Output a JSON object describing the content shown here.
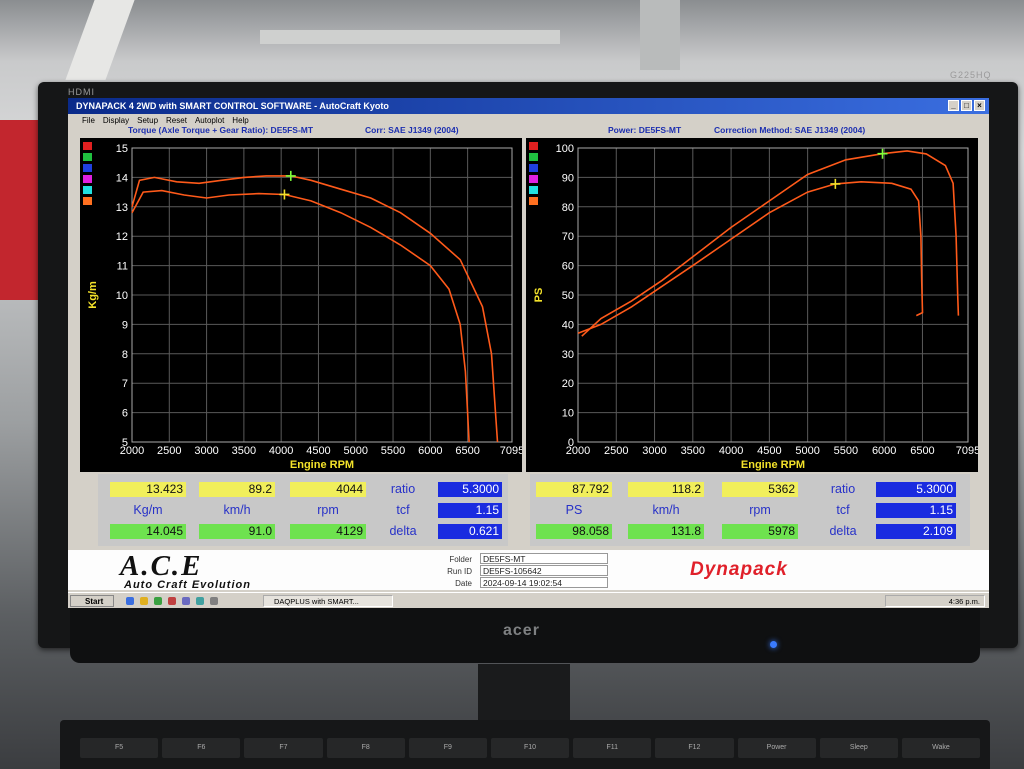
{
  "window": {
    "title": "DYNAPACK 4 2WD with SMART CONTROL SOFTWARE - AutoCraft Kyoto",
    "menu": [
      "File",
      "Display",
      "Setup",
      "Reset",
      "Autoplot",
      "Help"
    ]
  },
  "monitor": {
    "brand": "acer",
    "model": "G225HQ",
    "hdmi": "HDMI"
  },
  "torque_header": {
    "title": "Torque (Axle Torque + Gear Ratio): DE5FS-MT",
    "corr": "Corr: SAE J1349 (2004)"
  },
  "power_header": {
    "title": "Power: DE5FS-MT",
    "method": "Correction Method: SAE J1349 (2004)"
  },
  "chart_data": [
    {
      "type": "line",
      "ylabel": "Kg/m",
      "xlabel": "Engine RPM",
      "xlim": [
        2000,
        7095
      ],
      "ylim": [
        5,
        15
      ],
      "xticks": [
        2000,
        2500,
        3000,
        3500,
        4000,
        4500,
        5000,
        5500,
        6000,
        6500,
        7095
      ],
      "yticks": [
        5,
        6,
        7,
        8,
        9,
        10,
        11,
        12,
        13,
        14,
        15
      ],
      "series": [
        {
          "color": "#ff5a1a",
          "points": [
            [
              2000,
              13.0
            ],
            [
              2100,
              13.9
            ],
            [
              2300,
              14.0
            ],
            [
              2600,
              13.85
            ],
            [
              2900,
              13.8
            ],
            [
              3200,
              13.9
            ],
            [
              3500,
              14.0
            ],
            [
              3800,
              14.05
            ],
            [
              4129,
              14.05
            ],
            [
              4400,
              13.9
            ],
            [
              4800,
              13.6
            ],
            [
              5200,
              13.3
            ],
            [
              5600,
              12.8
            ],
            [
              6000,
              12.1
            ],
            [
              6400,
              11.2
            ],
            [
              6700,
              9.6
            ],
            [
              6820,
              8.0
            ],
            [
              6860,
              6.5
            ],
            [
              6900,
              5.0
            ]
          ]
        },
        {
          "color": "#ff5a1a",
          "points": [
            [
              2000,
              12.8
            ],
            [
              2150,
              13.5
            ],
            [
              2400,
              13.55
            ],
            [
              2700,
              13.4
            ],
            [
              3000,
              13.3
            ],
            [
              3300,
              13.4
            ],
            [
              3700,
              13.45
            ],
            [
              4044,
              13.42
            ],
            [
              4400,
              13.2
            ],
            [
              4800,
              12.8
            ],
            [
              5200,
              12.3
            ],
            [
              5600,
              11.7
            ],
            [
              6000,
              11.0
            ],
            [
              6250,
              10.2
            ],
            [
              6400,
              9.0
            ],
            [
              6470,
              7.4
            ],
            [
              6500,
              6.0
            ],
            [
              6520,
              5.0
            ]
          ]
        }
      ],
      "markers": [
        [
          4129,
          14.05
        ],
        [
          4044,
          13.42
        ]
      ]
    },
    {
      "type": "line",
      "ylabel": "PS",
      "xlabel": "Engine RPM",
      "xlim": [
        2000,
        7095
      ],
      "ylim": [
        0,
        100
      ],
      "xticks": [
        2000,
        2500,
        3000,
        3500,
        4000,
        4500,
        5000,
        5500,
        6000,
        6500,
        7095
      ],
      "yticks": [
        0,
        10,
        20,
        30,
        40,
        50,
        60,
        70,
        80,
        90,
        100
      ],
      "series": [
        {
          "color": "#ff5a1a",
          "points": [
            [
              2050,
              36
            ],
            [
              2300,
              42
            ],
            [
              2700,
              48
            ],
            [
              3100,
              55
            ],
            [
              3500,
              63
            ],
            [
              4000,
              73
            ],
            [
              4500,
              82
            ],
            [
              5000,
              91
            ],
            [
              5500,
              96
            ],
            [
              5978,
              98.06
            ],
            [
              6300,
              99
            ],
            [
              6550,
              98
            ],
            [
              6800,
              94
            ],
            [
              6900,
              88
            ],
            [
              6940,
              70
            ],
            [
              6960,
              50
            ],
            [
              6970,
              43
            ]
          ]
        },
        {
          "color": "#ff5a1a",
          "points": [
            [
              2000,
              37
            ],
            [
              2300,
              40
            ],
            [
              2700,
              46
            ],
            [
              3100,
              53
            ],
            [
              3500,
              60
            ],
            [
              4000,
              69
            ],
            [
              4500,
              78
            ],
            [
              5000,
              85
            ],
            [
              5362,
              87.79
            ],
            [
              5700,
              88.5
            ],
            [
              6100,
              88
            ],
            [
              6350,
              86
            ],
            [
              6450,
              82
            ],
            [
              6480,
              70
            ],
            [
              6490,
              55
            ],
            [
              6500,
              44
            ],
            [
              6420,
              43
            ]
          ]
        }
      ],
      "markers": [
        [
          5978,
          98.06
        ],
        [
          5362,
          87.79
        ]
      ]
    }
  ],
  "readout_left": {
    "row1": [
      "13.423",
      "89.2",
      "4044"
    ],
    "units": [
      "Kg/m",
      "km/h",
      "rpm"
    ],
    "row2": [
      "14.045",
      "91.0",
      "4129"
    ],
    "labels": [
      "ratio",
      "tcf",
      "delta"
    ],
    "values": [
      "5.3000",
      "1.15",
      "0.621"
    ]
  },
  "readout_right": {
    "row1": [
      "87.792",
      "118.2",
      "5362"
    ],
    "units": [
      "PS",
      "km/h",
      "rpm"
    ],
    "row2": [
      "98.058",
      "131.8",
      "5978"
    ],
    "labels": [
      "ratio",
      "tcf",
      "delta"
    ],
    "values": [
      "5.3000",
      "1.15",
      "2.109"
    ]
  },
  "footer": {
    "logo": "A.C.E",
    "logo_sub": "Auto Craft Evolution",
    "folder_label": "Folder",
    "folder": "DE5FS-MT",
    "runid_label": "Run ID",
    "runid": "DE5FS-105642",
    "date_label": "Date",
    "date": "2024-09-14 19:02:54",
    "dynapack": "Dynapack"
  },
  "taskbar": {
    "start": "Start",
    "task": "DAQPLUS with SMART...",
    "clock": "4:36 p.m."
  },
  "keyboard": [
    "F5",
    "F6",
    "F7",
    "F8",
    "F9",
    "F10",
    "F11",
    "F12",
    "Power",
    "Sleep",
    "Wake"
  ]
}
